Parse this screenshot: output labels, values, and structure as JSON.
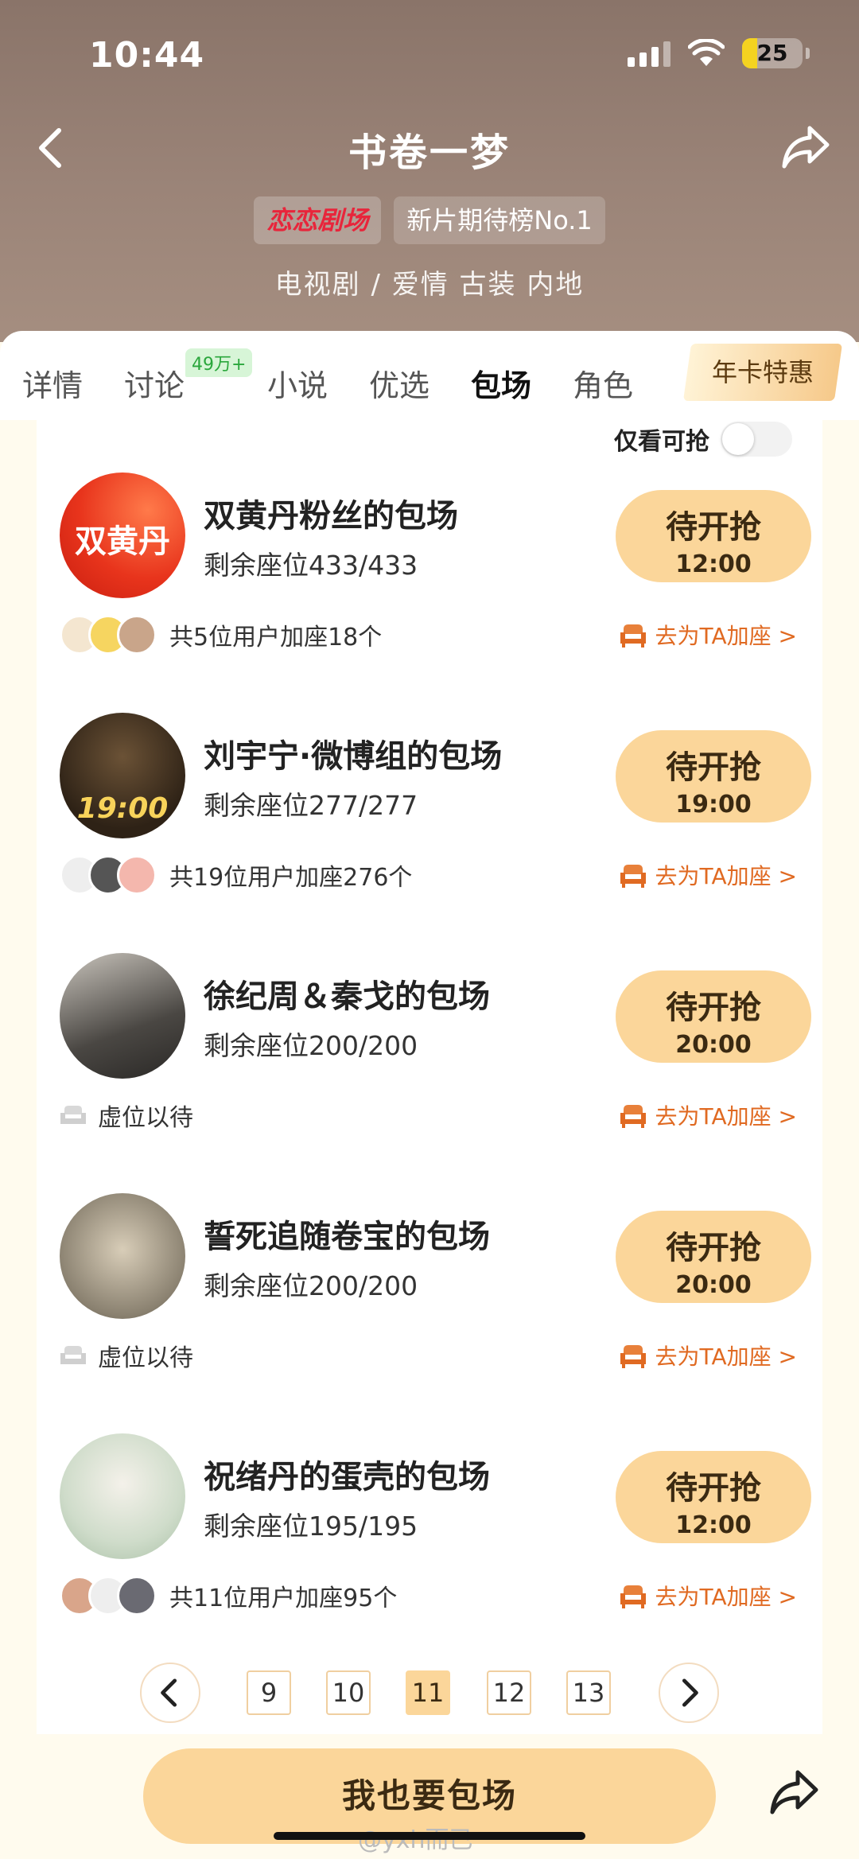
{
  "status_bar": {
    "time": "10:44",
    "battery": "25"
  },
  "header": {
    "title": "书卷一梦",
    "brand_badge": "恋恋剧场",
    "rank_badge": "新片期待榜No.1",
    "genre": "电视剧 / 爱情 古装 内地"
  },
  "tabs": {
    "items": [
      "详情",
      "讨论",
      "小说",
      "优选",
      "包场",
      "角色"
    ],
    "active": "包场",
    "discussion_badge": "49万+",
    "vip": "年卡特惠"
  },
  "filter": {
    "label": "仅看可抢",
    "enabled": false
  },
  "cards": [
    {
      "title": "双黄丹粉丝的包场",
      "seats": "剩余座位433/433",
      "button": "待开抢",
      "time": "12:00",
      "avatar_text": "双黄丹",
      "footer": "共5位用户加座18个",
      "link": "去为TA加座 >",
      "avatar_color": "#e8341c"
    },
    {
      "title": "刘宇宁·微博组的包场",
      "seats": "剩余座位277/277",
      "button": "待开抢",
      "time": "19:00",
      "avatar_text": "19:00",
      "footer": "共19位用户加座276个",
      "link": "去为TA加座 >",
      "avatar_color": "#3a2a1c"
    },
    {
      "title": "徐纪周＆秦戈的包场",
      "seats": "剩余座位200/200",
      "button": "待开抢",
      "time": "20:00",
      "avatar_text": "",
      "footer": "虚位以待",
      "link": "去为TA加座 >",
      "avatar_color": "#6c6a66"
    },
    {
      "title": "誓死追随卷宝的包场",
      "seats": "剩余座位200/200",
      "button": "待开抢",
      "time": "20:00",
      "avatar_text": "",
      "footer": "虚位以待",
      "link": "去为TA加座 >",
      "avatar_color": "#a9a394"
    },
    {
      "title": "祝绪丹的蛋壳的包场",
      "seats": "剩余座位195/195",
      "button": "待开抢",
      "time": "12:00",
      "avatar_text": "",
      "footer": "共11位用户加座95个",
      "link": "去为TA加座 >",
      "avatar_color": "#d7e4d6"
    }
  ],
  "pagination": {
    "pages": [
      "9",
      "10",
      "11",
      "12",
      "13"
    ],
    "current": "11"
  },
  "bottom": {
    "cta": "我也要包场"
  },
  "watermark": "@yxh而已",
  "colors": {
    "accent": "#fbd69a",
    "link": "#e06a22",
    "header": "#9b8478"
  }
}
